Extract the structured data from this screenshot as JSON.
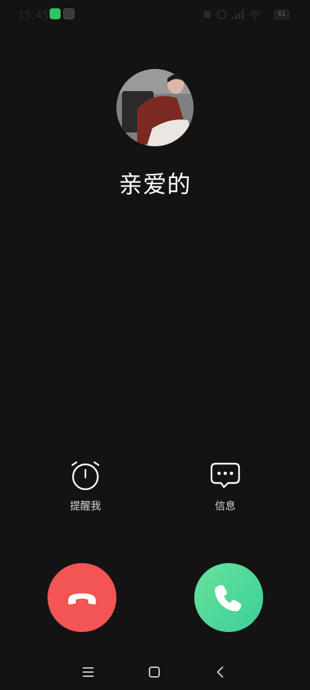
{
  "status_bar": {
    "time": "15:45",
    "battery": "61",
    "apps": [
      "wechat-icon",
      "app-icon"
    ]
  },
  "caller": {
    "name": "亲爱的"
  },
  "actions": {
    "remind_label": "提醒我",
    "message_label": "信息"
  },
  "colors": {
    "background": "#131313",
    "decline": "#f35454",
    "accept_start": "#68e29a",
    "accept_end": "#3ccf9a"
  },
  "nav_bar": {
    "icons": [
      "menu-icon",
      "home-icon",
      "back-icon"
    ]
  }
}
